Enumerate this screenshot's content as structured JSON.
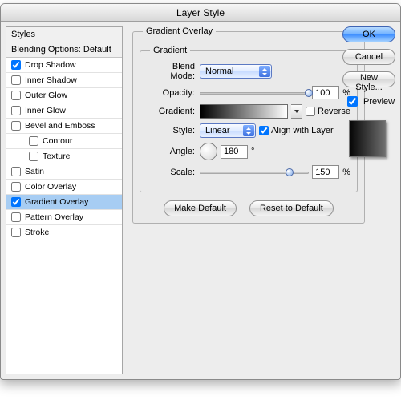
{
  "window": {
    "title": "Layer Style"
  },
  "sidebar": {
    "styles_header": "Styles",
    "blending_header": "Blending Options: Default",
    "items": [
      {
        "label": "Drop Shadow",
        "checked": true
      },
      {
        "label": "Inner Shadow",
        "checked": false
      },
      {
        "label": "Outer Glow",
        "checked": false
      },
      {
        "label": "Inner Glow",
        "checked": false
      },
      {
        "label": "Bevel and Emboss",
        "checked": false
      },
      {
        "label": "Contour",
        "checked": false,
        "indent": true
      },
      {
        "label": "Texture",
        "checked": false,
        "indent": true
      },
      {
        "label": "Satin",
        "checked": false
      },
      {
        "label": "Color Overlay",
        "checked": false
      },
      {
        "label": "Gradient Overlay",
        "checked": true,
        "selected": true
      },
      {
        "label": "Pattern Overlay",
        "checked": false
      },
      {
        "label": "Stroke",
        "checked": false
      }
    ]
  },
  "panel": {
    "group_label": "Gradient Overlay",
    "subgroup_label": "Gradient",
    "blend_mode_label": "Blend Mode:",
    "blend_mode_value": "Normal",
    "opacity_label": "Opacity:",
    "opacity_value": "100",
    "percent": "%",
    "gradient_label": "Gradient:",
    "reverse_label": "Reverse",
    "reverse_checked": false,
    "style_label": "Style:",
    "style_value": "Linear",
    "align_label": "Align with Layer",
    "align_checked": true,
    "angle_label": "Angle:",
    "angle_value": "180",
    "degree": "°",
    "scale_label": "Scale:",
    "scale_value": "150",
    "make_default_label": "Make Default",
    "reset_default_label": "Reset to Default"
  },
  "buttons": {
    "ok": "OK",
    "cancel": "Cancel",
    "new_style": "New Style...",
    "preview_label": "Preview",
    "preview_checked": true
  }
}
